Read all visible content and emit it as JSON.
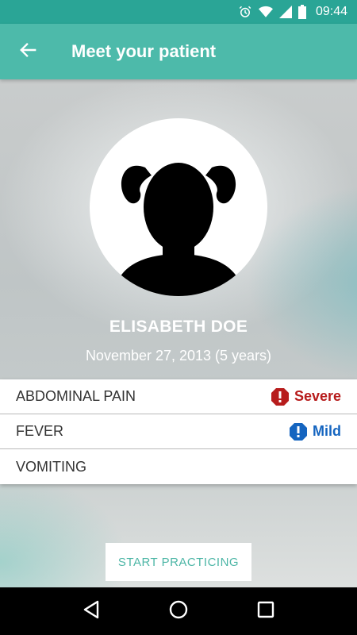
{
  "status_bar": {
    "time": "09:44",
    "icons": [
      "alarm-icon",
      "wifi-icon",
      "signal-icon",
      "battery-icon"
    ]
  },
  "app_bar": {
    "title": "Meet your patient",
    "back_icon": "arrow-back-icon",
    "background": "#4dbaaa"
  },
  "patient": {
    "name": "ELISABETH DOE",
    "dob": "November 27, 2013 (5 years)",
    "avatar_icon": "girl-silhouette-icon"
  },
  "symptoms": [
    {
      "name": "ABDOMINAL PAIN",
      "severity": "Severe",
      "severity_color": "#b71c1c",
      "icon": "alert-octagon-icon"
    },
    {
      "name": "FEVER",
      "severity": "Mild",
      "severity_color": "#1565c0",
      "icon": "alert-octagon-icon"
    },
    {
      "name": "VOMITING",
      "severity": "",
      "severity_color": "",
      "icon": ""
    }
  ],
  "actions": {
    "start_label": "START PRACTICING",
    "accent": "#4db6a6"
  },
  "nav_bar": {
    "icons": [
      "back-triangle-icon",
      "home-circle-icon",
      "recents-square-icon"
    ]
  }
}
